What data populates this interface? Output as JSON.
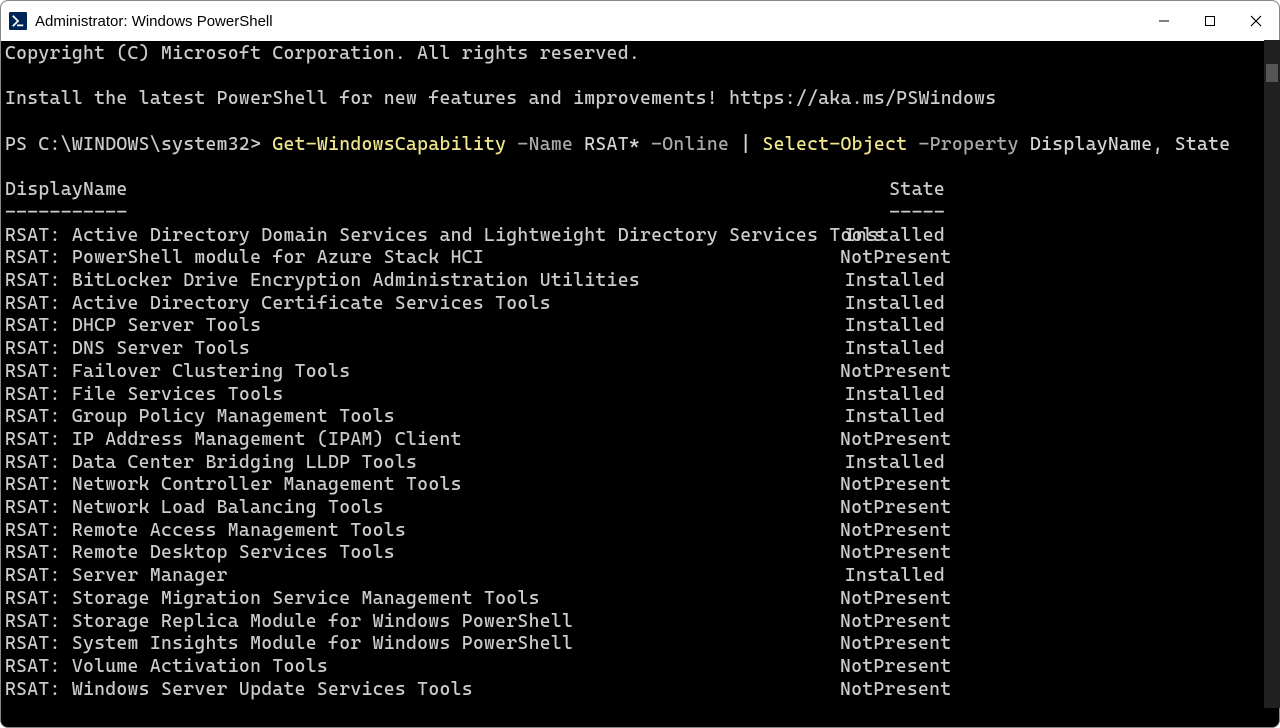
{
  "titlebar": {
    "title": "Administrator: Windows PowerShell"
  },
  "banner": {
    "copyright": "Copyright (C) Microsoft Corporation. All rights reserved.",
    "install_msg": "Install the latest PowerShell for new features and improvements! https://aka.ms/PSWindows"
  },
  "prompt": "PS C:\\WINDOWS\\system32> ",
  "command": {
    "cmdlet1": "Get-WindowsCapability",
    "param1": " -Name",
    "arg1": " RSAT*",
    "param2": " -Online",
    "pipe": " | ",
    "cmdlet2": "Select-Object",
    "param3": " -Property",
    "arg3a": " DisplayName",
    "comma": ",",
    "arg3b": " State"
  },
  "headers": {
    "name": "DisplayName",
    "state": "State",
    "name_rule": "-----------",
    "state_rule": "-----"
  },
  "rows": [
    {
      "name": "RSAT: Active Directory Domain Services and Lightweight Directory Services Tools",
      "state": "Installed"
    },
    {
      "name": "RSAT: PowerShell module for Azure Stack HCI",
      "state": "NotPresent"
    },
    {
      "name": "RSAT: BitLocker Drive Encryption Administration Utilities",
      "state": "Installed"
    },
    {
      "name": "RSAT: Active Directory Certificate Services Tools",
      "state": "Installed"
    },
    {
      "name": "RSAT: DHCP Server Tools",
      "state": "Installed"
    },
    {
      "name": "RSAT: DNS Server Tools",
      "state": "Installed"
    },
    {
      "name": "RSAT: Failover Clustering Tools",
      "state": "NotPresent"
    },
    {
      "name": "RSAT: File Services Tools",
      "state": "Installed"
    },
    {
      "name": "RSAT: Group Policy Management Tools",
      "state": "Installed"
    },
    {
      "name": "RSAT: IP Address Management (IPAM) Client",
      "state": "NotPresent"
    },
    {
      "name": "RSAT: Data Center Bridging LLDP Tools",
      "state": "Installed"
    },
    {
      "name": "RSAT: Network Controller Management Tools",
      "state": "NotPresent"
    },
    {
      "name": "RSAT: Network Load Balancing Tools",
      "state": "NotPresent"
    },
    {
      "name": "RSAT: Remote Access Management Tools",
      "state": "NotPresent"
    },
    {
      "name": "RSAT: Remote Desktop Services Tools",
      "state": "NotPresent"
    },
    {
      "name": "RSAT: Server Manager",
      "state": "Installed"
    },
    {
      "name": "RSAT: Storage Migration Service Management Tools",
      "state": "NotPresent"
    },
    {
      "name": "RSAT: Storage Replica Module for Windows PowerShell",
      "state": "NotPresent"
    },
    {
      "name": "RSAT: System Insights Module for Windows PowerShell",
      "state": "NotPresent"
    },
    {
      "name": "RSAT: Volume Activation Tools",
      "state": "NotPresent"
    },
    {
      "name": "RSAT: Windows Server Update Services Tools",
      "state": "NotPresent"
    }
  ]
}
